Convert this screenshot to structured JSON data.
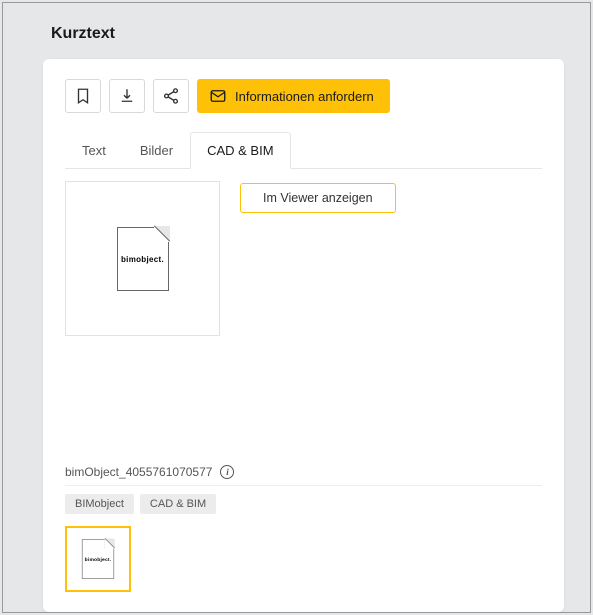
{
  "page_title": "Kurztext",
  "toolbar": {
    "request_label": "Informationen anfordern"
  },
  "tabs": [
    {
      "label": "Text",
      "active": false
    },
    {
      "label": "Bilder",
      "active": false
    },
    {
      "label": "CAD & BIM",
      "active": true
    }
  ],
  "viewer_button": "Im Viewer anzeigen",
  "preview_watermark": "bimobject.",
  "file_name": "bimObject_4055761070577",
  "tags": [
    "BIMobject",
    "CAD & BIM"
  ]
}
